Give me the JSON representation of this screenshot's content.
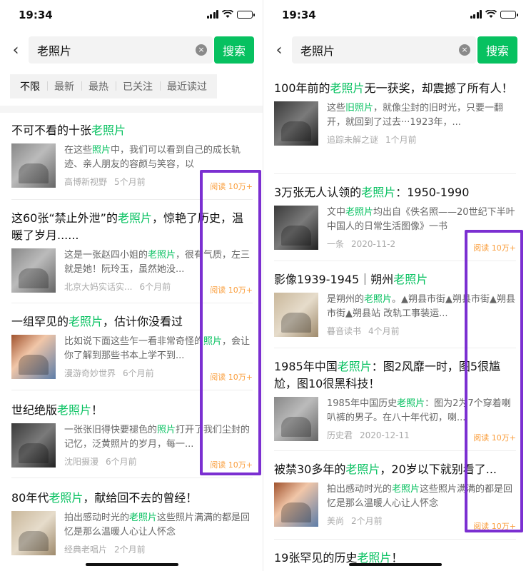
{
  "left": {
    "status_time": "19:34",
    "search": {
      "back": "‹",
      "query": "老照片",
      "clear": "×",
      "button": "搜索"
    },
    "filters": [
      "不限",
      "最新",
      "最热",
      "已关注",
      "最近读过"
    ],
    "articles": [
      {
        "title_pre": "不可不看的十张",
        "title_hl": "老照片",
        "title_post": "",
        "snippet_pre": "在这些",
        "snippet_hl": "照片",
        "snippet_post": "中，我们可以看到自己的成长轨迹、亲人朋友的容颜与笑容，以",
        "source": "高博新视野",
        "time": "5个月前",
        "reads": "阅读 10万+"
      },
      {
        "title_pre": "这60张“禁止外泄”的",
        "title_hl": "老照片",
        "title_post": "，惊艳了历史，温暖了岁月......",
        "snippet_pre": "这是一张赵四小姐的",
        "snippet_hl": "老照片",
        "snippet_post": "，很有气质，左三就是她！阮玲玉，虽然她没...",
        "source": "北京大妈实话实...",
        "time": "6个月前",
        "reads": "阅读 10万+"
      },
      {
        "title_pre": "一组罕见的",
        "title_hl": "老照片",
        "title_post": "，估计你没看过",
        "snippet_pre": "比如说下面这些乍一看非常奇怪的",
        "snippet_hl": "照片",
        "snippet_post": "，会让你了解到那些书本上学不到...",
        "source": "漫游奇妙世界",
        "time": "6个月前",
        "reads": "阅读 10万+"
      },
      {
        "title_pre": "世纪绝版",
        "title_hl": "老照片",
        "title_post": "！",
        "snippet_pre": "一张张旧得快要褪色的",
        "snippet_hl": "照片",
        "snippet_post": "打开了我们尘封的记忆，泛黄照片的岁月，每一...",
        "source": "沈阳摄漫",
        "time": "6个月前",
        "reads": "阅读 10万+"
      },
      {
        "title_pre": "80年代",
        "title_hl": "老照片",
        "title_post": "，献给回不去的曾经！",
        "snippet_pre": "拍出感动时光的",
        "snippet_hl": "老照片",
        "snippet_post": "这些照片满满的都是回忆是那么温暖人心让人怀念",
        "source": "经典老唱片",
        "time": "2个月前",
        "reads": ""
      }
    ]
  },
  "right": {
    "status_time": "19:34",
    "search": {
      "back": "‹",
      "query": "老照片",
      "clear": "×",
      "button": "搜索"
    },
    "articles": [
      {
        "title_pre": "100年前的",
        "title_hl": "老照片",
        "title_post": "无一获奖，却震撼了所有人！",
        "snippet_pre": "这些",
        "snippet_hl": "旧照片",
        "snippet_post": "，就像尘封的旧时光，只要一翻开，就回到了过去···1923年，...",
        "source": "追踪未解之谜",
        "time": "1个月前",
        "reads": ""
      },
      {
        "title_pre": "3万张无人认领的",
        "title_hl": "老照片",
        "title_post": "：1950-1990",
        "snippet_pre": "文中",
        "snippet_hl": "老照片",
        "snippet_post": "均出自《佚名照——20世纪下半叶中国人的日常生活图像》一书",
        "source": "一条",
        "time": "2020-11-2",
        "reads": "阅读 10万+"
      },
      {
        "title_pre": "影像1939-1945｜朔州",
        "title_hl": "老照片",
        "title_post": "",
        "snippet_pre": "是朔州的",
        "snippet_hl": "老照片",
        "snippet_post": "。▲朔县市街▲朔县市街▲朔县市街▲朔县站 改轨工事装运...",
        "source": "暮音读书",
        "time": "4个月前",
        "reads": ""
      },
      {
        "title_pre": "1985年中国",
        "title_hl": "老照片",
        "title_post": "：图2风靡一时，图5很尴尬，图10很黑科技！",
        "snippet_pre": "1985年中国历史",
        "snippet_hl": "老照片",
        "snippet_post": "：图为2为7个穿着喇叭裤的男子。在八十年代初，喇...",
        "source": "历史君",
        "time": "2020-12-11",
        "reads": "阅读 10万+"
      },
      {
        "title_pre": "被禁30多年的",
        "title_hl": "老照片",
        "title_post": "，20岁以下就别看了...",
        "snippet_pre": "拍出感动时光的",
        "snippet_hl": "老照片",
        "snippet_post": "这些照片满满的都是回忆是那么温暖人心让人怀念",
        "source": "美尚",
        "time": "2个月前",
        "reads": "阅读 10万+"
      },
      {
        "title_pre": "19张罕见的历史",
        "title_hl": "老照片",
        "title_post": "！",
        "snippet_pre": "",
        "snippet_hl": "",
        "snippet_post": "",
        "source": "",
        "time": "",
        "reads": ""
      }
    ]
  },
  "colors": {
    "accent": "#07c160",
    "reads": "#fa9d3b",
    "highlight_box": "#7b2fd1"
  },
  "icons": [
    "back-arrow-icon",
    "clear-icon",
    "signal-icon",
    "wifi-icon",
    "battery-icon"
  ]
}
